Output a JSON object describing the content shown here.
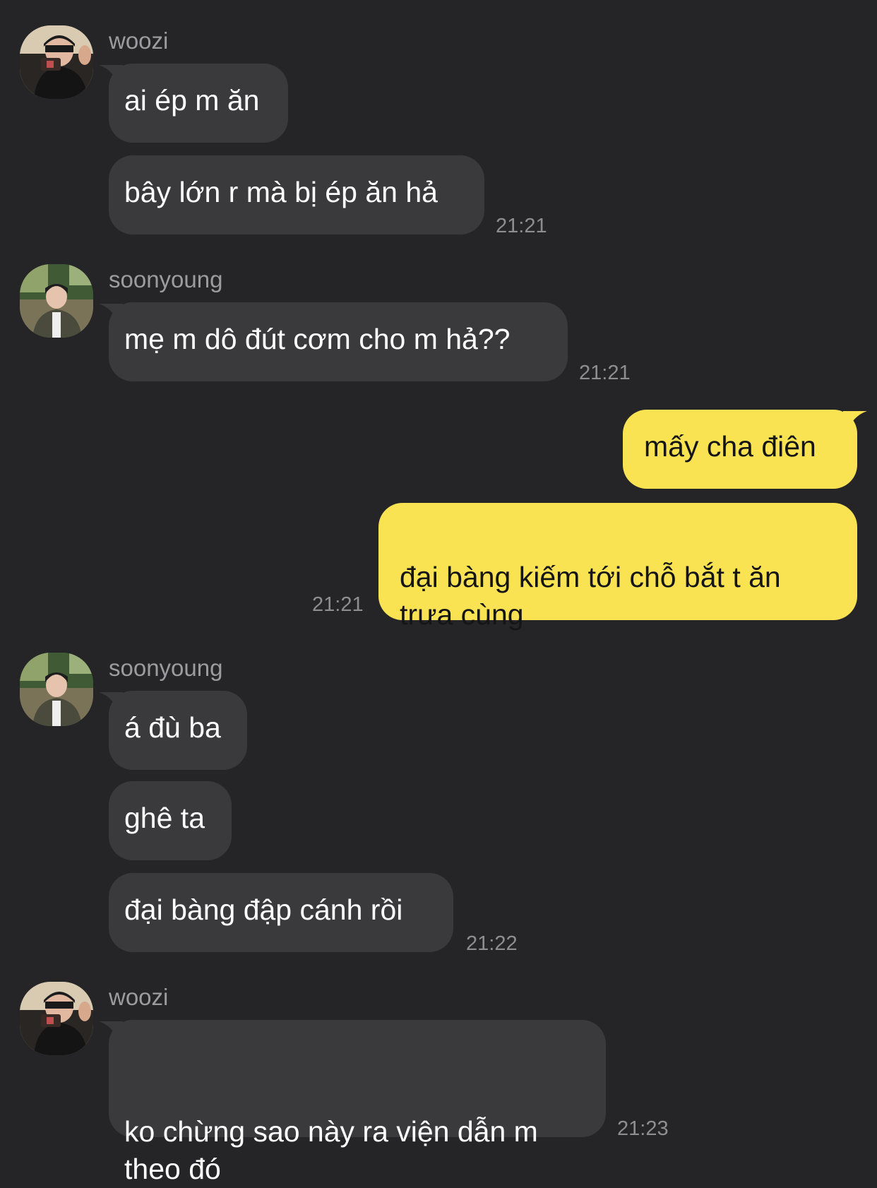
{
  "colors": {
    "background": "#252527",
    "incoming_bubble": "#3a3a3c",
    "outgoing_bubble": "#f9e352",
    "sender_text": "#9c9ca0",
    "time_text": "#8e8e92"
  },
  "groups": [
    {
      "sender": "woozi",
      "avatar_icon": "user-avatar-photo",
      "messages": [
        "ai ép m ăn",
        "bây lớn r mà bị ép ăn hả"
      ],
      "time": "21:21"
    },
    {
      "sender": "soonyoung",
      "avatar_icon": "user-avatar-photo",
      "messages": [
        "mẹ m dô đút cơm cho m hả??"
      ],
      "time": "21:21"
    },
    {
      "sender": "me",
      "outgoing": true,
      "messages": [
        "mấy cha điên",
        "đại bàng kiếm tới chỗ bắt t ăn\ntrưa cùng"
      ],
      "time": "21:21"
    },
    {
      "sender": "soonyoung",
      "avatar_icon": "user-avatar-photo",
      "messages": [
        "á đù ba",
        "ghê ta",
        "đại bàng đập cánh rồi"
      ],
      "time": "21:22"
    },
    {
      "sender": "woozi",
      "avatar_icon": "user-avatar-photo",
      "messages": [
        "ko chừng sao này ra viện dẫn m\ntheo đó"
      ],
      "time": "21:23"
    }
  ]
}
